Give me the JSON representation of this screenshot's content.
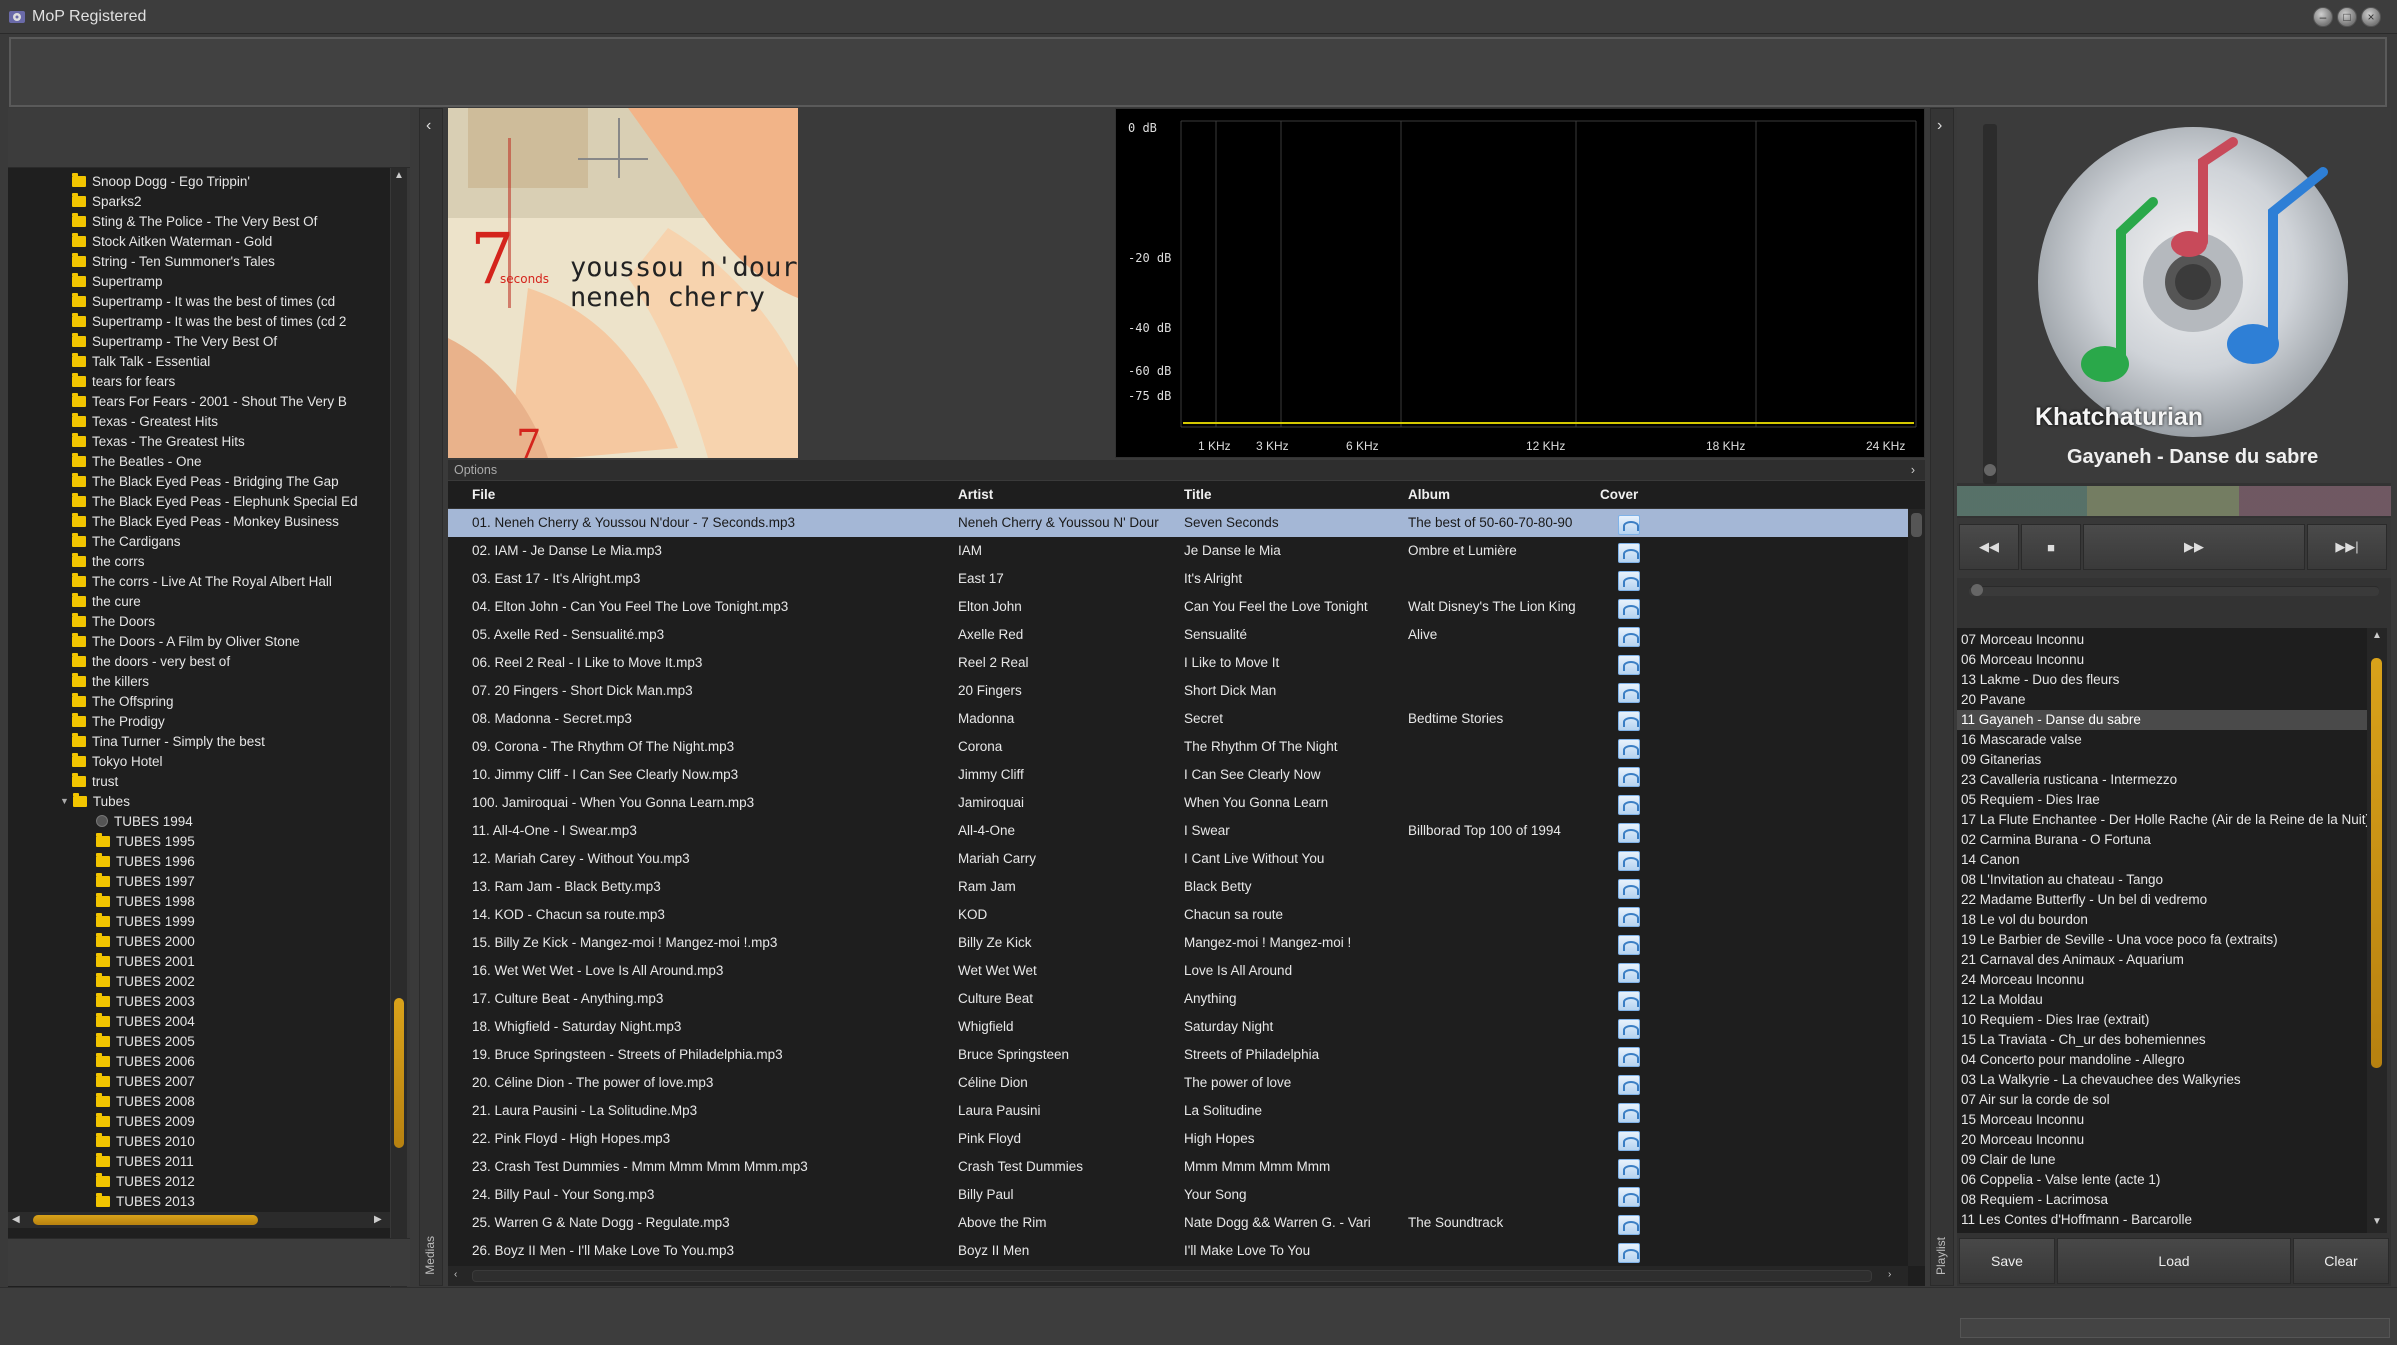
{
  "window": {
    "title": "MoP Registered",
    "buttons": {
      "minimize": "–",
      "maximize": "□",
      "close": "×"
    }
  },
  "left_panel": {
    "tree_items": [
      "Snoop Dogg - Ego Trippin'",
      "Sparks2",
      "Sting & The Police - The Very Best Of",
      "Stock Aitken Waterman - Gold",
      "String - Ten Summoner's Tales",
      "Supertramp",
      "Supertramp - It was the best of times (cd",
      "Supertramp - It was the best of times (cd 2",
      "Supertramp - The Very Best Of",
      "Talk Talk - Essential",
      "tears for fears",
      "Tears For Fears - 2001 - Shout The Very B",
      "Texas - Greatest Hits",
      "Texas - The Greatest Hits",
      "The Beatles - One",
      "The Black Eyed Peas - Bridging The Gap",
      "The Black Eyed Peas - Elephunk Special Ed",
      "The Black Eyed Peas - Monkey Business",
      "The Cardigans",
      "the corrs",
      "The corrs - Live At The Royal Albert Hall",
      "the cure",
      "The Doors",
      "The Doors - A Film by Oliver Stone",
      "the doors - very best of",
      "the killers",
      "The Offspring",
      "The Prodigy",
      "Tina Turner - Simply the best",
      "Tokyo Hotel",
      "trust",
      "Tubes"
    ],
    "tubes_children": [
      "TUBES 1994",
      "TUBES 1995",
      "TUBES 1996",
      "TUBES 1997",
      "TUBES 1998",
      "TUBES 1999",
      "TUBES 2000",
      "TUBES 2001",
      "TUBES 2002",
      "TUBES 2003",
      "TUBES 2004",
      "TUBES 2005",
      "TUBES 2006",
      "TUBES 2007",
      "TUBES 2008",
      "TUBES 2009",
      "TUBES 2010",
      "TUBES 2011",
      "TUBES 2012",
      "TUBES 2013"
    ]
  },
  "side_labels": {
    "medias": "Medias",
    "playlist": "Playlist"
  },
  "cover": {
    "line1": "youssou n'dour",
    "line2": "neneh cherry",
    "number": "7",
    "small": "seconds"
  },
  "spectrum": {
    "db_labels": [
      "0 dB",
      "-20 dB",
      "-40 dB",
      "-60 dB",
      "-75 dB"
    ],
    "khz_labels": [
      "1 KHz",
      "3 KHz",
      "6 KHz",
      "12 KHz",
      "18 KHz",
      "24 KHz"
    ],
    "line_color": "#d4c800"
  },
  "options_label": "Options",
  "tracklist": {
    "columns": {
      "file": "File",
      "artist": "Artist",
      "title": "Title",
      "album": "Album",
      "cover": "Cover"
    },
    "rows": [
      {
        "file": "01. Neneh Cherry & Youssou N'dour - 7 Seconds.mp3",
        "artist": "Neneh Cherry & Youssou N' Dour",
        "title": "Seven Seconds",
        "album": "The best of 50-60-70-80-90"
      },
      {
        "file": "02. IAM - Je Danse Le Mia.mp3",
        "artist": "IAM",
        "title": "Je Danse le Mia",
        "album": "Ombre et Lumière"
      },
      {
        "file": "03. East 17 - It's Alright.mp3",
        "artist": "East 17",
        "title": "It's Alright",
        "album": ""
      },
      {
        "file": "04. Elton John - Can You Feel The Love Tonight.mp3",
        "artist": "Elton John",
        "title": "Can You Feel the Love Tonight",
        "album": "Walt Disney's The Lion King"
      },
      {
        "file": "05. Axelle Red - Sensualité.mp3",
        "artist": "Axelle Red",
        "title": "Sensualité",
        "album": "Alive"
      },
      {
        "file": "06. Reel 2 Real - I Like to Move It.mp3",
        "artist": "Reel 2 Real",
        "title": "I Like to Move It",
        "album": ""
      },
      {
        "file": "07. 20 Fingers - Short Dick Man.mp3",
        "artist": "20 Fingers",
        "title": "Short Dick Man",
        "album": ""
      },
      {
        "file": "08. Madonna - Secret.mp3",
        "artist": "Madonna",
        "title": "Secret",
        "album": "Bedtime Stories"
      },
      {
        "file": "09. Corona - The Rhythm Of The Night.mp3",
        "artist": "Corona",
        "title": "The Rhythm Of The Night",
        "album": ""
      },
      {
        "file": "10. Jimmy Cliff - I Can See Clearly Now.mp3",
        "artist": "Jimmy Cliff",
        "title": "I Can See Clearly Now",
        "album": ""
      },
      {
        "file": "100. Jamiroquai - When You Gonna Learn.mp3",
        "artist": "Jamiroquai",
        "title": "When You Gonna Learn",
        "album": ""
      },
      {
        "file": "11. All-4-One - I Swear.mp3",
        "artist": "All-4-One",
        "title": "I Swear",
        "album": "Billborad Top 100 of 1994"
      },
      {
        "file": "12. Mariah Carey - Without You.mp3",
        "artist": "Mariah Carry",
        "title": "I Cant Live Without You",
        "album": ""
      },
      {
        "file": "13. Ram Jam - Black Betty.mp3",
        "artist": "Ram Jam",
        "title": "Black Betty",
        "album": ""
      },
      {
        "file": "14. KOD - Chacun sa route.mp3",
        "artist": "KOD",
        "title": "Chacun sa route",
        "album": ""
      },
      {
        "file": "15. Billy Ze Kick - Mangez-moi ! Mangez-moi !.mp3",
        "artist": "Billy Ze Kick",
        "title": "Mangez-moi ! Mangez-moi !",
        "album": ""
      },
      {
        "file": "16. Wet Wet Wet - Love Is All Around.mp3",
        "artist": "Wet Wet Wet",
        "title": "Love Is All Around",
        "album": ""
      },
      {
        "file": "17. Culture Beat - Anything.mp3",
        "artist": "Culture Beat",
        "title": "Anything",
        "album": ""
      },
      {
        "file": "18. Whigfield - Saturday Night.mp3",
        "artist": "Whigfield",
        "title": "Saturday Night",
        "album": ""
      },
      {
        "file": "19. Bruce Springsteen - Streets of Philadelphia.mp3",
        "artist": "Bruce Springsteen",
        "title": "Streets of Philadelphia",
        "album": ""
      },
      {
        "file": "20. Céline Dion - The power of love.mp3",
        "artist": "Céline Dion",
        "title": "The power of love",
        "album": ""
      },
      {
        "file": "21. Laura Pausini - La Solitudine.Mp3",
        "artist": "Laura Pausini",
        "title": "La Solitudine",
        "album": ""
      },
      {
        "file": "22. Pink Floyd - High Hopes.mp3",
        "artist": "Pink Floyd",
        "title": "High Hopes",
        "album": ""
      },
      {
        "file": "23. Crash Test Dummies - Mmm Mmm Mmm Mmm.mp3",
        "artist": "Crash Test Dummies",
        "title": "Mmm Mmm Mmm Mmm",
        "album": ""
      },
      {
        "file": "24. Billy Paul - Your Song.mp3",
        "artist": "Billy Paul",
        "title": "Your Song",
        "album": ""
      },
      {
        "file": "25. Warren G & Nate Dogg - Regulate.mp3",
        "artist": "Above the Rim",
        "title": "Nate Dogg && Warren G. - Vari",
        "album": "The Soundtrack"
      },
      {
        "file": "26. Boyz II Men - I'll Make Love To You.mp3",
        "artist": "Boyz II Men",
        "title": "I'll Make Love To You",
        "album": ""
      }
    ]
  },
  "now_playing": {
    "artist": "Khatchaturian",
    "title": "Gayaneh - Danse du sabre"
  },
  "playlist": {
    "items": [
      "07 Morceau Inconnu",
      "06 Morceau Inconnu",
      "13 Lakme - Duo des fleurs",
      "20 Pavane",
      "11 Gayaneh - Danse du sabre",
      "16 Mascarade valse",
      "09 Gitanerias",
      "23 Cavalleria rusticana - Intermezzo",
      "05 Requiem - Dies Irae",
      "17 La Flute Enchantee - Der Holle Rache (Air de la Reine de la Nuit)",
      "02 Carmina Burana - O Fortuna",
      "14 Canon",
      "08 L'Invitation au chateau - Tango",
      "22 Madame Butterfly - Un bel di vedremo",
      "18 Le vol du bourdon",
      "19 Le Barbier de Seville - Una voce poco fa (extraits)",
      "21 Carnaval des Animaux - Aquarium",
      "24 Morceau Inconnu",
      "12 La Moldau",
      "10 Requiem - Dies Irae (extrait)",
      "15 La Traviata - Ch_ur des bohemiennes",
      "04 Concerto pour mandoline - Allegro",
      "03 La Walkyrie - La chevauchee des Walkyries",
      "07 Air sur la corde de sol",
      "15 Morceau Inconnu",
      "20 Morceau Inconnu",
      "09 Clair de lune",
      "06 Coppelia - Valse lente (acte 1)",
      "08 Requiem - Lacrimosa",
      "11 Les Contes d'Hoffmann - Barcarolle"
    ],
    "current_index": 4,
    "buttons": {
      "save": "Save",
      "load": "Load",
      "clear": "Clear"
    }
  },
  "colors": {
    "folder": "#f2c500",
    "selection": "#a4b7d6",
    "scroll_thumb": "#d9a21a"
  }
}
